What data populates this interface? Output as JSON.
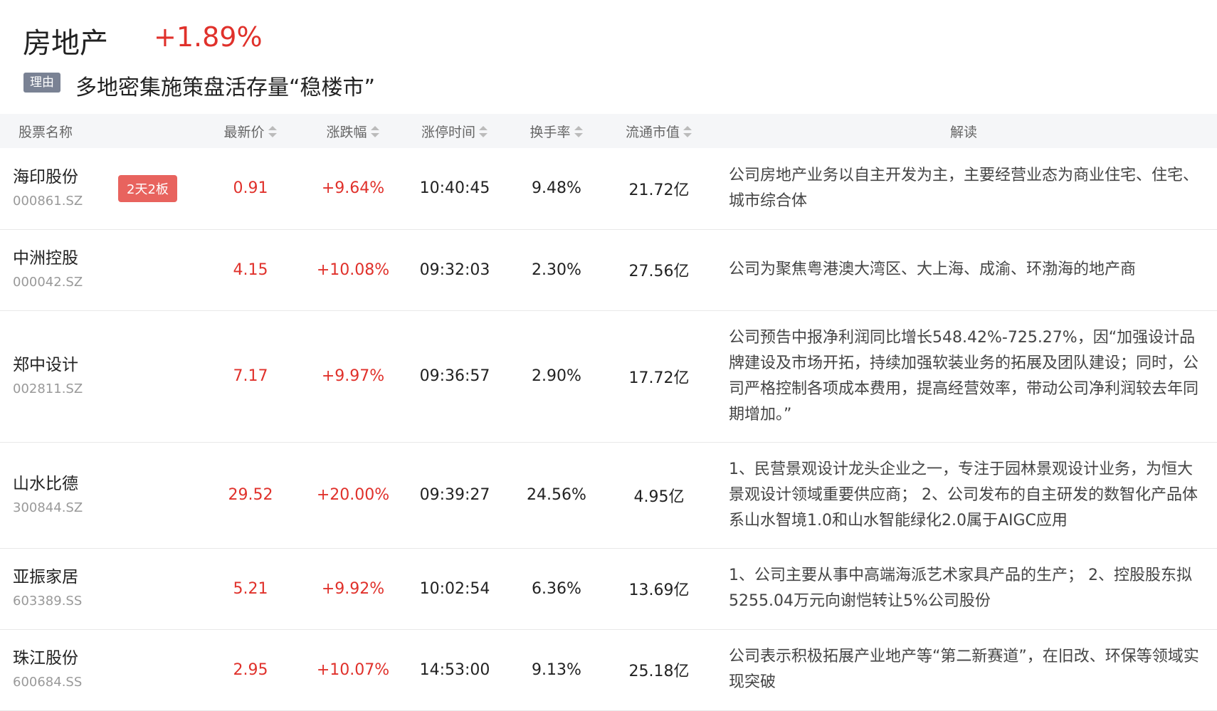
{
  "sector": {
    "name": "房地产",
    "change": "+1.89%",
    "reason_label": "理由",
    "reason_text": "多地密集施策盘活存量“稳楼市”"
  },
  "table": {
    "headers": {
      "name": "股票名称",
      "price": "最新价",
      "change": "涨跌幅",
      "limit_time": "涨停时间",
      "turnover": "换手率",
      "market_cap": "流通市值",
      "comment": "解读"
    },
    "rows": [
      {
        "name": "海印股份",
        "code": "000861.SZ",
        "tag": "2天2板",
        "price": "0.91",
        "change": "+9.64%",
        "limit_time": "10:40:45",
        "turnover": "9.48%",
        "market_cap": "21.72亿",
        "comment": "公司房地产业务以自主开发为主，主要经营业态为商业住宅、住宅、城市综合体"
      },
      {
        "name": "中洲控股",
        "code": "000042.SZ",
        "tag": "",
        "price": "4.15",
        "change": "+10.08%",
        "limit_time": "09:32:03",
        "turnover": "2.30%",
        "market_cap": "27.56亿",
        "comment": "公司为聚焦粤港澳大湾区、大上海、成渝、环渤海的地产商"
      },
      {
        "name": "郑中设计",
        "code": "002811.SZ",
        "tag": "",
        "price": "7.17",
        "change": "+9.97%",
        "limit_time": "09:36:57",
        "turnover": "2.90%",
        "market_cap": "17.72亿",
        "comment": "公司预告中报净利润同比增长548.42%-725.27%，因“加强设计品牌建设及市场开拓，持续加强软装业务的拓展及团队建设；同时，公司严格控制各项成本费用，提高经营效率，带动公司净利润较去年同期增加。”"
      },
      {
        "name": "山水比德",
        "code": "300844.SZ",
        "tag": "",
        "price": "29.52",
        "change": "+20.00%",
        "limit_time": "09:39:27",
        "turnover": "24.56%",
        "market_cap": "4.95亿",
        "comment": "1、民营景观设计龙头企业之一，专注于园林景观设计业务，为恒大景观设计领域重要供应商； 2、公司发布的自主研发的数智化产品体系山水智境1.0和山水智能绿化2.0属于AIGC应用"
      },
      {
        "name": "亚振家居",
        "code": "603389.SS",
        "tag": "",
        "price": "5.21",
        "change": "+9.92%",
        "limit_time": "10:02:54",
        "turnover": "6.36%",
        "market_cap": "13.69亿",
        "comment": "1、公司主要从事中高端海派艺术家具产品的生产； 2、控股股东拟5255.04万元向谢恺转让5%公司股份"
      },
      {
        "name": "珠江股份",
        "code": "600684.SS",
        "tag": "",
        "price": "2.95",
        "change": "+10.07%",
        "limit_time": "14:53:00",
        "turnover": "9.13%",
        "market_cap": "25.18亿",
        "comment": "公司表示积极拓展产业地产等“第二新赛道”，在旧改、环保等领域实现突破"
      }
    ]
  },
  "colors": {
    "up": "#e0312b",
    "badge": "#7a8294",
    "tag": "#e8635e"
  }
}
